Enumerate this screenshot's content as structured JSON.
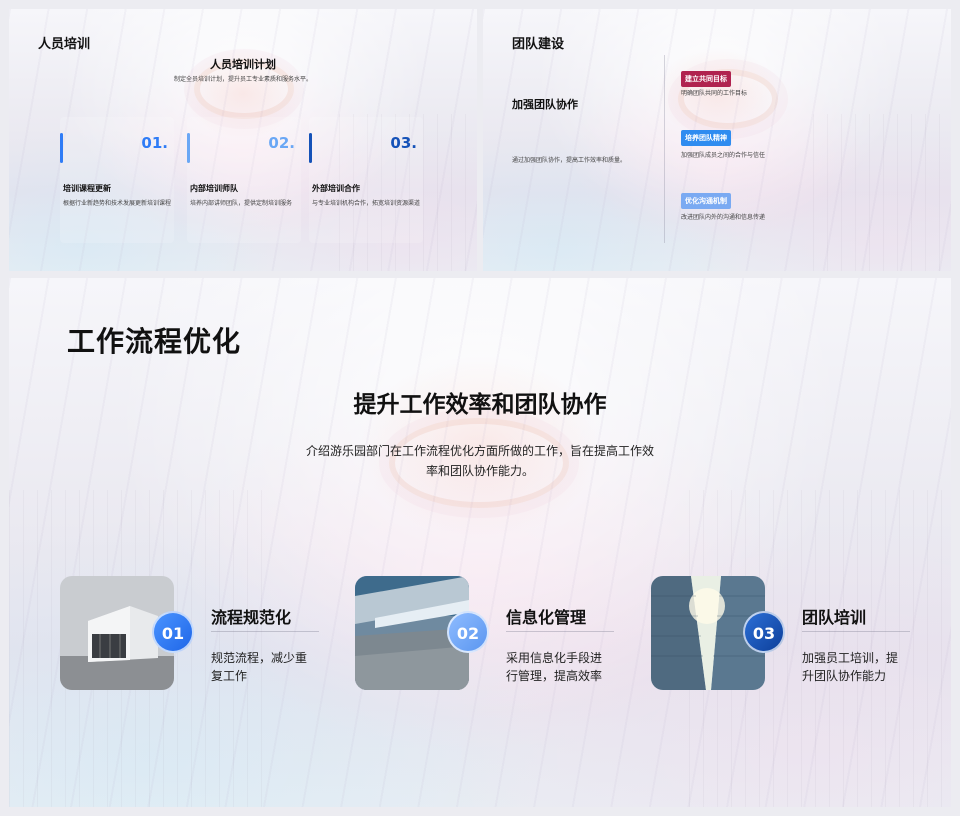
{
  "slide1": {
    "title": "人员培训",
    "heading": "人员培训计划",
    "subheading": "制定全员培训计划，提升员工专业素质和服务水平。",
    "cards": [
      {
        "num": "01.",
        "title": "培训课程更新",
        "desc": "根据行业新趋势和技术发展更新培训课程",
        "color": "#2f7cf6"
      },
      {
        "num": "02.",
        "title": "内部培训师队",
        "desc": "培养内部讲师团队，提供定制培训服务",
        "color": "#6aa7f5"
      },
      {
        "num": "03.",
        "title": "外部培训合作",
        "desc": "与专业培训机构合作，拓宽培训资源渠道",
        "color": "#1552b8"
      }
    ]
  },
  "slide2": {
    "title": "团队建设",
    "heading": "加强团队协作",
    "desc": "通过加强团队协作，提高工作效率和质量。",
    "items": [
      {
        "tag": "建立共同目标",
        "desc": "明确团队共同的工作目标",
        "color": "#b0234f"
      },
      {
        "tag": "培养团队精神",
        "desc": "加强团队成员之间的合作与信任",
        "color": "#2f8cf0"
      },
      {
        "tag": "优化沟通机制",
        "desc": "改进团队内外的沟通和信息传递",
        "color": "#7aaaf2"
      }
    ]
  },
  "slide3": {
    "title": "工作流程优化",
    "heading": "提升工作效率和团队协作",
    "intro": "介绍游乐园部门在工作流程优化方面所做的工作，旨在提高工作效率和团队协作能力。",
    "items": [
      {
        "num": "01",
        "title": "流程规范化",
        "desc": "规范流程，减少重复工作",
        "image": "modern-building-photo",
        "color": "#2f7cf6"
      },
      {
        "num": "02",
        "title": "信息化管理",
        "desc": "采用信息化手段进行管理，提高效率",
        "image": "architecture-photo",
        "color": "#6aa7f5"
      },
      {
        "num": "03",
        "title": "团队培训",
        "desc": "加强员工培训，提升团队协作能力",
        "image": "skyscraper-photo",
        "color": "#1552b8"
      }
    ]
  }
}
